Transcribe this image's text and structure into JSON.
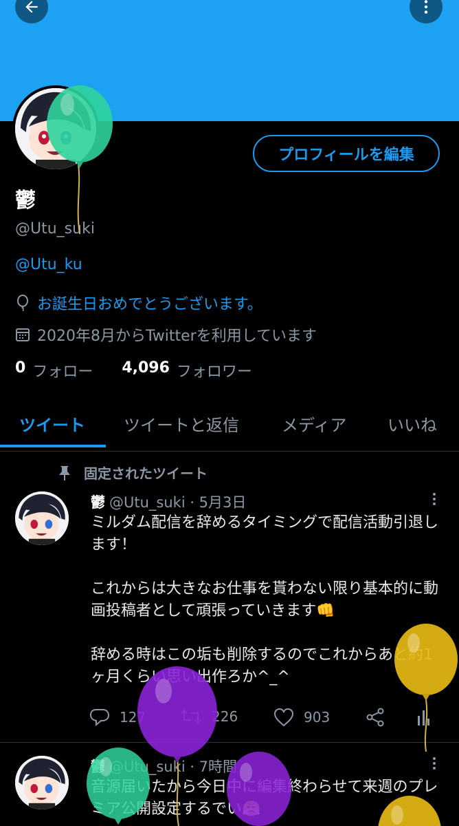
{
  "colors": {
    "banner": "#1da1f2",
    "accent": "#1d9bf0",
    "muted": "#8b98a5",
    "background": "#000000"
  },
  "header": {
    "back_icon": "arrow-left-icon",
    "more_icon": "more-vertical-icon"
  },
  "profile": {
    "edit_button": "プロフィールを編集",
    "display_name": "鬱",
    "handle": "@Utu_suki",
    "bio_link": "@Utu_ku",
    "birthday_text": "お誕生日おめでとうございます。",
    "joined_text": "2020年8月からTwitterを利用しています",
    "following_count": "0",
    "following_label": "フォロー",
    "followers_count": "4,096",
    "followers_label": "フォロワー"
  },
  "tabs": [
    {
      "label": "ツイート",
      "active": true
    },
    {
      "label": "ツイートと返信",
      "active": false
    },
    {
      "label": "メディア",
      "active": false
    },
    {
      "label": "いいね",
      "active": false
    }
  ],
  "pinned_label": "固定されたツイート",
  "tweets": [
    {
      "name": "鬱",
      "handle_time": "@Utu_suki · 5月3日",
      "text": "ミルダム配信を辞めるタイミングで配信活動引退します！\n\nこれからは大きなお仕事を貰わない限り基本的に動画投稿者として頑張っていきます👊\n\n辞める時はこの垢も削除するのでこれからあと約1ヶ月くらい思い出作ろか^_^",
      "reply_count": "127",
      "retweet_count": "226",
      "like_count": "903"
    },
    {
      "name": "鬱",
      "handle_time": "@Utu_suki · 7時間",
      "text": "音源届いたから今日中に編集終わらせて来週のプレミア公開設定するでい😤"
    }
  ]
}
